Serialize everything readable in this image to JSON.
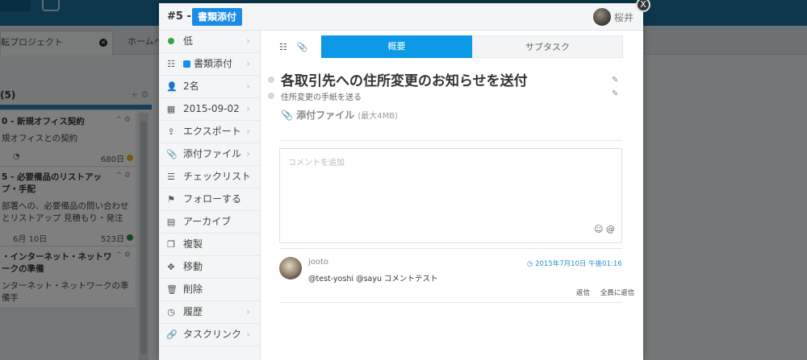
{
  "background": {
    "tab_active": "転プロジェクト",
    "tab_other": "ホームペ",
    "column_title": "(5)",
    "column_icons": "+ ⚙",
    "cards": [
      {
        "title": "0 - 新規オフィス契約",
        "desc": "規オフィスとの契約",
        "footer_right": "680日",
        "dot": "#e8b41a"
      },
      {
        "title": "5 - 必要備品のリストアップ・手配",
        "desc": "部署への、必要備品の問い合わせとリストアップ 見積もり・発注",
        "footer_left": "6月 10日",
        "footer_right": "523日",
        "dot": "#2e8f3e"
      },
      {
        "title": "・インターネット・ネットワークの準備",
        "desc": "ンターネット・ネットワークの準備手"
      }
    ]
  },
  "modal": {
    "number": "#5 -",
    "badge": "書類添付",
    "user": "桜井",
    "close_label": "X",
    "sidebar": [
      {
        "icon": "priority-dot",
        "label": "低"
      },
      {
        "icon": "list-icon",
        "label": "書類添付"
      },
      {
        "icon": "user-plus-icon",
        "label": "2名"
      },
      {
        "icon": "calendar-icon",
        "label": "2015-09-02"
      },
      {
        "icon": "export-icon",
        "label": "エクスポート"
      },
      {
        "icon": "paperclip-icon",
        "label": "添付ファイル"
      },
      {
        "icon": "checklist-icon",
        "label": "チェックリスト"
      },
      {
        "icon": "follow-icon",
        "label": "フォローする"
      },
      {
        "icon": "archive-icon",
        "label": "アーカイブ"
      },
      {
        "icon": "copy-icon",
        "label": "複製"
      },
      {
        "icon": "move-icon",
        "label": "移動"
      },
      {
        "icon": "trash-icon",
        "label": "削除"
      },
      {
        "icon": "history-icon",
        "label": "履歴"
      },
      {
        "icon": "link-icon",
        "label": "タスクリンク"
      }
    ],
    "tabs": {
      "overview": "概要",
      "subtask": "サブタスク"
    },
    "task": {
      "title": "各取引先への住所変更のお知らせを送付",
      "subtitle": "住所変更の手紙を送る",
      "attach_label": "添付ファイル",
      "attach_limit": "(最大4MB)"
    },
    "comment_input": {
      "placeholder": "コメントを追加",
      "emoji": "☺ @"
    },
    "comment": {
      "author": "jooto",
      "time": "◷ 2015年7月10日 午後01:16",
      "text": "@test-yoshi @sayu コメントテスト",
      "reply": "返信",
      "reply_all": "全員に返信"
    },
    "colors": {
      "accent": "#0c9ae8",
      "badge": "#1a8ce8",
      "priority": "#3aa24a"
    }
  }
}
